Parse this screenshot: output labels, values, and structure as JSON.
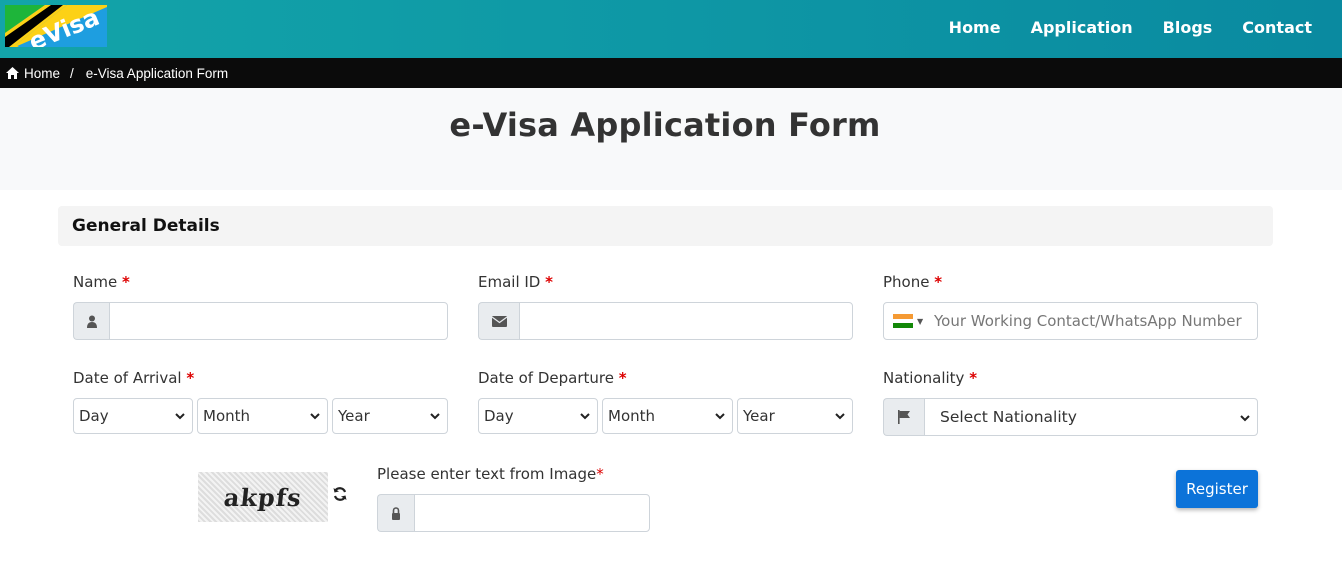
{
  "header": {
    "logo_text": "eVisa",
    "nav": [
      "Home",
      "Application",
      "Blogs",
      "Contact"
    ]
  },
  "breadcrumb": {
    "home": "Home",
    "separator": "/",
    "current": "e-Visa Application Form"
  },
  "page_title": "e-Visa Application Form",
  "section_title": "General Details",
  "form": {
    "name_label": "Name",
    "email_label": "Email ID",
    "phone_label": "Phone",
    "phone_placeholder": "Your Working Contact/WhatsApp Number",
    "arrival_label": "Date of Arrival",
    "departure_label": "Date of Departure",
    "nationality_label": "Nationality",
    "nationality_value": "Select Nationality",
    "day": "Day",
    "month": "Month",
    "year": "Year",
    "required_mark": "*",
    "captcha_label": "Please enter text from Image",
    "captcha_text": "akpfs",
    "register": "Register"
  },
  "colors": {
    "header_teal": "#0f9aa6",
    "button_blue": "#0c73d9",
    "required_red": "#dd0000"
  }
}
